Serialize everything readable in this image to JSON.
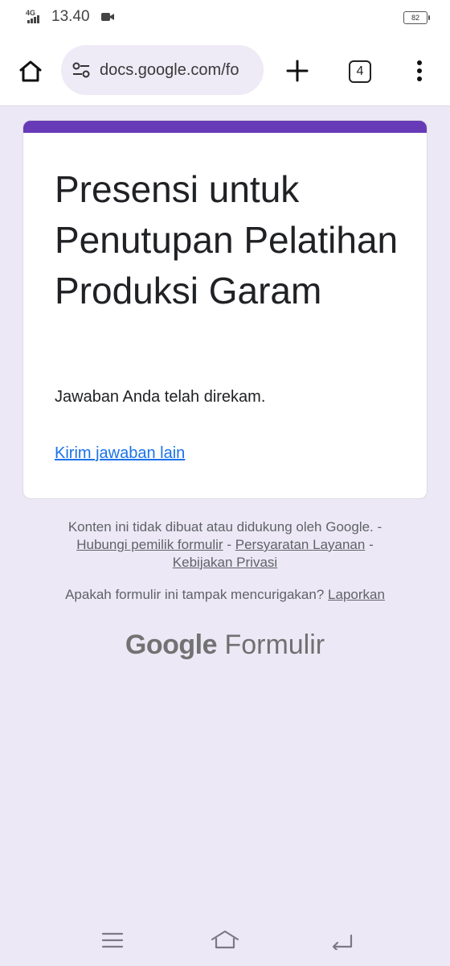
{
  "status_bar": {
    "network": "4G",
    "time": "13.40",
    "battery": "82"
  },
  "browser": {
    "url": "docs.google.com/fo",
    "tab_count": "4"
  },
  "form": {
    "title": "Presensi untuk Penutupan Pelatihan Produksi Garam",
    "message": "Jawaban Anda telah direkam.",
    "another_response_link": "Kirim jawaban lain",
    "accent_color": "#673ab7"
  },
  "footer": {
    "disclaimer": "Konten ini tidak dibuat atau didukung oleh Google. -",
    "contact_owner_link": "Hubungi pemilik formulir",
    "separator": "-",
    "terms_link": "Persyaratan Layanan",
    "privacy_link": "Kebijakan Privasi",
    "report_question": "Apakah formulir ini tampak mencurigakan?",
    "report_link": "Laporkan"
  },
  "brand": {
    "google": "Google",
    "product": "Formulir"
  },
  "icons": {
    "home": "home-icon",
    "site_settings": "tune-icon",
    "new_tab": "plus-icon",
    "menu": "more-vert-icon",
    "recents": "menu-lines-icon",
    "nav_home": "home-outline-icon",
    "back": "back-icon",
    "video": "video-camera-icon"
  }
}
